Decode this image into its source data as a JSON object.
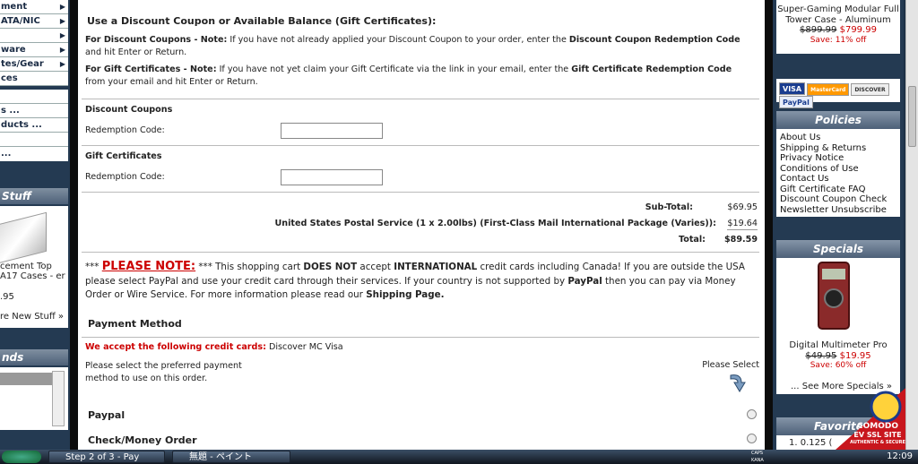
{
  "left": {
    "menu": [
      "ment",
      "ATA/NIC",
      "",
      "ware",
      "tes/Gear",
      "ces"
    ],
    "menu2": [
      "",
      "s ...",
      "ducts ...",
      "",
      ""
    ],
    "stuff_title": "Stuff",
    "stuff_desc": "cement Top A17 Cases - er",
    "stuff_price": ".95",
    "stuff_more": "re New Stuff »",
    "brands_title": "nds"
  },
  "main": {
    "discount_heading": "Use a Discount Coupon or Available Balance (Gift Certificates):",
    "note_coupons_lead": "For Discount Coupons - Note:",
    "note_coupons_body": " If you have not already applied your Discount Coupon to your order, enter the ",
    "note_coupons_bold": "Discount Coupon Redemption Code",
    "note_coupons_tail": " and hit Enter or Return.",
    "note_gift_lead": "For Gift Certificates - Note:",
    "note_gift_body": " If you have not yet claim your Gift Certificate via the link in your email, enter the ",
    "note_gift_bold": "Gift Certificate Redemption Code",
    "note_gift_tail": " from your email and hit Enter or Return.",
    "coupons_title": "Discount Coupons",
    "coupons_label": "Redemption Code:",
    "gift_title": "Gift Certificates",
    "gift_label": "Redemption Code:",
    "subtotal_label": "Sub-Total:",
    "subtotal_value": "$69.95",
    "shipping_label": "United States Postal Service (1 x 2.00lbs) (First-Class Mail International Package (Varies)):",
    "shipping_value": "$19.64",
    "total_label": "Total:",
    "total_value": "$89.59",
    "note_stars": "*** ",
    "note_red": "PLEASE NOTE:",
    "note_p1": " *** This shopping cart ",
    "note_b1": "DOES NOT",
    "note_p2": " accept ",
    "note_b2": "INTERNATIONAL",
    "note_p3": " credit cards including Canada! If you are outside the USA please select PayPal and use your credit card through their services. If your country is not supported by ",
    "note_b3": "PayPal",
    "note_p4": "  then you can pay via Money Order or Wire Service. For more information please read our ",
    "note_b4": "Shipping Page.",
    "payment_title": "Payment Method",
    "accept_red": "We accept the following credit cards:",
    "accept_cards": " Discover MC Visa",
    "select_text": "Please select the preferred payment method to use on this order.",
    "please_select": "Please Select",
    "opt_paypal": "Paypal",
    "opt_check": "Check/Money Order"
  },
  "right": {
    "prod_name": "Super-Gaming Modular Full Tower Case - Aluminum",
    "prod_old": "$899.99",
    "prod_new": "$799.99",
    "prod_save": "Save: 11% off",
    "cards": [
      "VISA",
      "MasterCard",
      "DISCOVER",
      "PayPal"
    ],
    "policies_title": "Policies",
    "policies": [
      "About Us",
      "Shipping & Returns",
      "Privacy Notice",
      "Conditions of Use",
      "Contact Us",
      "Gift Certificate FAQ",
      "Discount Coupon Check",
      "Newsletter Unsubscribe"
    ],
    "specials_title": "Specials",
    "special_name": "Digital Multimeter Pro",
    "special_old": "$49.95",
    "special_new": "$19.95",
    "special_save": "Save: 60% off",
    "special_more": "... See More Specials »",
    "favorites_title": "Favorites",
    "fav_item": "1. 0.125 (",
    "comodo_name": "COMODO",
    "comodo_sub": "EV SSL SITE",
    "comodo_tag": "AUTHENTIC & SECURE"
  },
  "taskbar": {
    "task1": "Step 2 of 3 - Pay",
    "task2": "無題 - ペイント",
    "clock": "12:09",
    "caps": "CAPS",
    "kana": "KANA"
  }
}
